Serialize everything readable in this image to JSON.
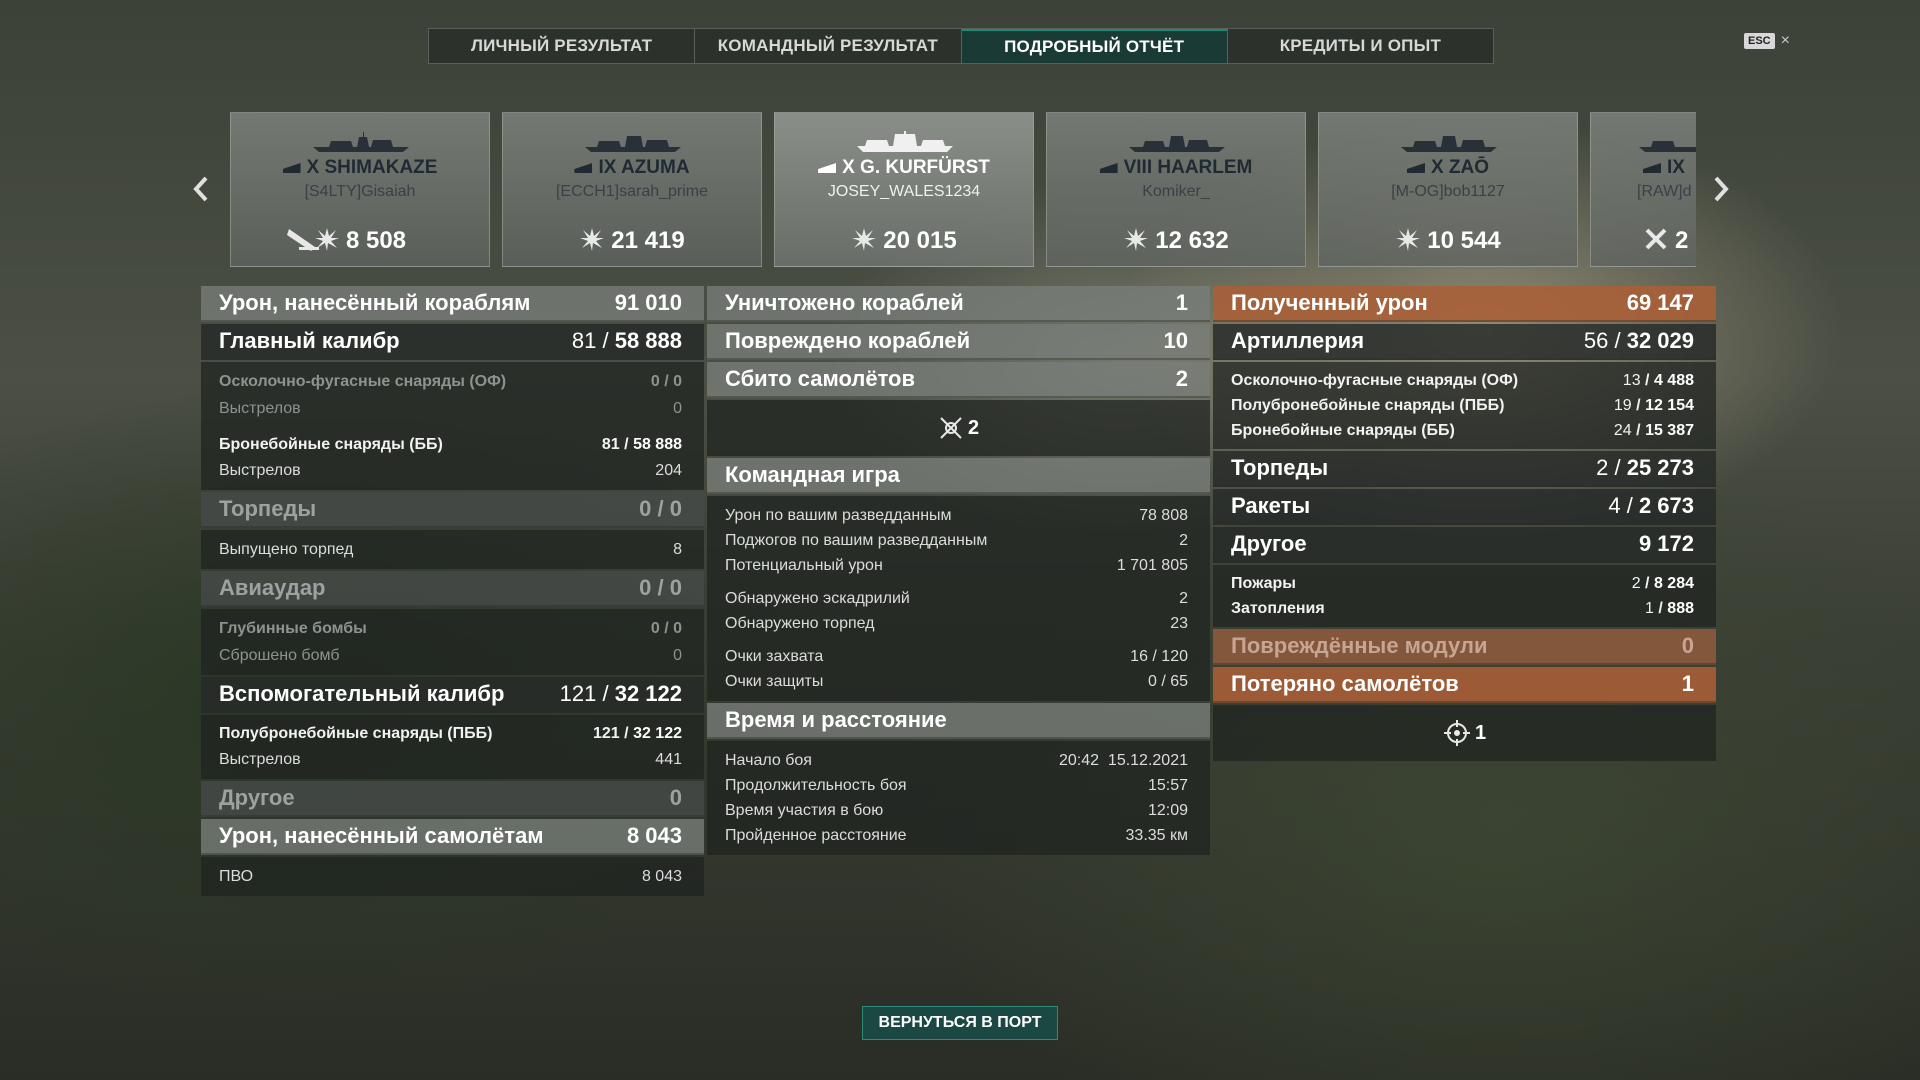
{
  "tabs": [
    "ЛИЧНЫЙ РЕЗУЛЬТАТ",
    "КОМАНДНЫЙ РЕЗУЛЬТАТ",
    "ПОДРОБНЫЙ ОТЧЁТ",
    "КРЕДИТЫ И ОПЫТ"
  ],
  "active_tab": "ПОДРОБНЫЙ ОТЧЁТ",
  "esc_label": "ESC",
  "close_label": "×",
  "ships": [
    {
      "name": "X SHIMAKAZE",
      "player": "[S4LTY]Gisaiah",
      "score": "8 508"
    },
    {
      "name": "IX AZUMA",
      "player": "[ECCH1]sarah_prime",
      "score": "21 419"
    },
    {
      "name": "X G. KURFÜRST",
      "player": "JOSEY_WALES1234",
      "score": "20 015"
    },
    {
      "name": "VIII HAARLEM",
      "player": "Komiker_",
      "score": "12 632"
    },
    {
      "name": "X ZAŌ",
      "player": "[M-OG]bob1127",
      "score": "10 544"
    },
    {
      "name": "IX",
      "player": "[RAW]d",
      "score": "2"
    }
  ],
  "damage": {
    "title": "Урон, нанесённый кораблям",
    "value": "91 010",
    "main_battery": {
      "label": "Главный калибр",
      "hits": "81",
      "dmg": "58 888"
    },
    "he": {
      "label": "Осколочно-фугасные снаряды (ОФ)",
      "hits": "0",
      "dmg": "0"
    },
    "he_shots": {
      "label": "Выстрелов",
      "value": "0"
    },
    "ap": {
      "label": "Бронебойные снаряды (ББ)",
      "hits": "81",
      "dmg": "58 888"
    },
    "ap_shots": {
      "label": "Выстрелов",
      "value": "204"
    },
    "torpedoes": {
      "label": "Торпеды",
      "hits": "0",
      "dmg": "0"
    },
    "torps_fired": {
      "label": "Выпущено торпед",
      "value": "8"
    },
    "airstrike": {
      "label": "Авиаудар",
      "hits": "0",
      "dmg": "0"
    },
    "depth": {
      "label": "Глубинные бомбы",
      "hits": "0",
      "dmg": "0"
    },
    "bombs": {
      "label": "Сброшено бомб",
      "value": "0"
    },
    "secondary": {
      "label": "Вспомогательный калибр",
      "hits": "121",
      "dmg": "32 122"
    },
    "sap": {
      "label": "Полубронебойные снаряды (ПББ)",
      "hits": "121",
      "dmg": "32 122"
    },
    "sec_shots": {
      "label": "Выстрелов",
      "value": "441"
    },
    "other": {
      "label": "Другое",
      "value": "0"
    },
    "planes_title": "Урон, нанесённый самолётам",
    "planes_value": "8 043",
    "aa": {
      "label": "ПВО",
      "value": "8 043"
    }
  },
  "middle": {
    "destroyed": {
      "label": "Уничтожено кораблей",
      "value": "1"
    },
    "damaged": {
      "label": "Повреждено кораблей",
      "value": "10"
    },
    "shot_down": {
      "label": "Сбито самолётов",
      "value": "2"
    },
    "shot_down_icon_count": "2",
    "team_title": "Командная игра",
    "team_rows": [
      {
        "label": "Урон по вашим разведданным",
        "value": "78 808"
      },
      {
        "label": "Поджогов по вашим разведданным",
        "value": "2"
      },
      {
        "label": "Потенциальный урон",
        "value": "1 701 805"
      },
      {
        "label": "Обнаружено эскадрилий",
        "value": "2"
      },
      {
        "label": "Обнаружено торпед",
        "value": "23"
      },
      {
        "label": "Очки захвата",
        "value": "16 / 120"
      },
      {
        "label": "Очки защиты",
        "value": "0 / 65"
      }
    ],
    "time_title": "Время и расстояние",
    "time_rows": [
      {
        "label": "Начало боя",
        "value": "20:42  15.12.2021"
      },
      {
        "label": "Продолжительность боя",
        "value": "15:57"
      },
      {
        "label": "Время участия в бою",
        "value": "12:09"
      },
      {
        "label": "Пройденное расстояние",
        "value": "33.35 км"
      }
    ]
  },
  "received": {
    "title": "Полученный урон",
    "value": "69 147",
    "artillery": {
      "label": "Артиллерия",
      "hits": "56",
      "dmg": "32 029"
    },
    "he": {
      "label": "Осколочно-фугасные снаряды (ОФ)",
      "hits": "13",
      "dmg": "4 488"
    },
    "sap": {
      "label": "Полубронебойные снаряды (ПББ)",
      "hits": "19",
      "dmg": "12 154"
    },
    "ap": {
      "label": "Бронебойные снаряды (ББ)",
      "hits": "24",
      "dmg": "15 387"
    },
    "torpedoes": {
      "label": "Торпеды",
      "hits": "2",
      "dmg": "25 273"
    },
    "rockets": {
      "label": "Ракеты",
      "hits": "4",
      "dmg": "2 673"
    },
    "other": {
      "label": "Другое",
      "value": "9 172"
    },
    "fires": {
      "label": "Пожары",
      "hits": "2",
      "dmg": "8 284"
    },
    "floods": {
      "label": "Затопления",
      "hits": "1",
      "dmg": "888"
    },
    "modules": {
      "label": "Повреждённые модули",
      "value": "0"
    },
    "planes_lost": {
      "label": "Потеряно самолётов",
      "value": "1"
    },
    "planes_lost_icon_count": "1"
  },
  "port_button": "ВЕРНУТЬСЯ В ПОРТ",
  "slash": "/",
  "colors": {
    "accent": "#1f8a7a",
    "orange": "#aa5f37"
  }
}
